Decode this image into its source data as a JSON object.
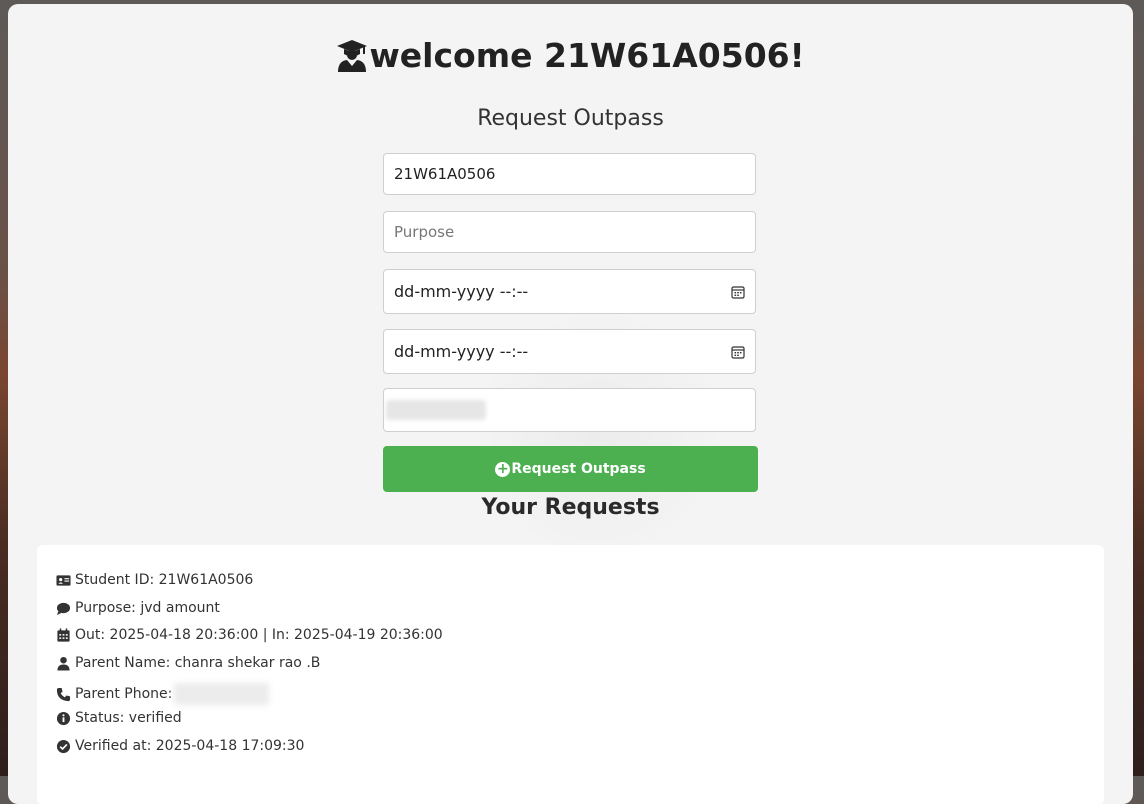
{
  "header": {
    "welcome_text": "welcome 21W61A0506!",
    "icon": "graduate-icon"
  },
  "form": {
    "title": "Request Outpass",
    "student_id_value": "21W61A0506",
    "purpose_placeholder": "Purpose",
    "out_datetime_placeholder": "dd-mm-yyyy --:--",
    "in_datetime_placeholder": "dd-mm-yyyy --:--",
    "submit_label": "Request Outpass"
  },
  "requests": {
    "title": "Your Requests",
    "items": [
      {
        "student_id": "Student ID: 21W61A0506",
        "purpose": "Purpose: jvd amount",
        "timing": "Out: 2025-04-18 20:36:00 | In: 2025-04-19 20:36:00",
        "parent_name": "Parent Name: chanra shekar rao .B",
        "parent_phone_label": "Parent Phone:",
        "status": "Status: verified",
        "verified_at": "Verified at: 2025-04-18 17:09:30"
      }
    ]
  },
  "colors": {
    "accent": "#4caf50",
    "card_bg": "#f4f4f4",
    "text": "#222222"
  }
}
